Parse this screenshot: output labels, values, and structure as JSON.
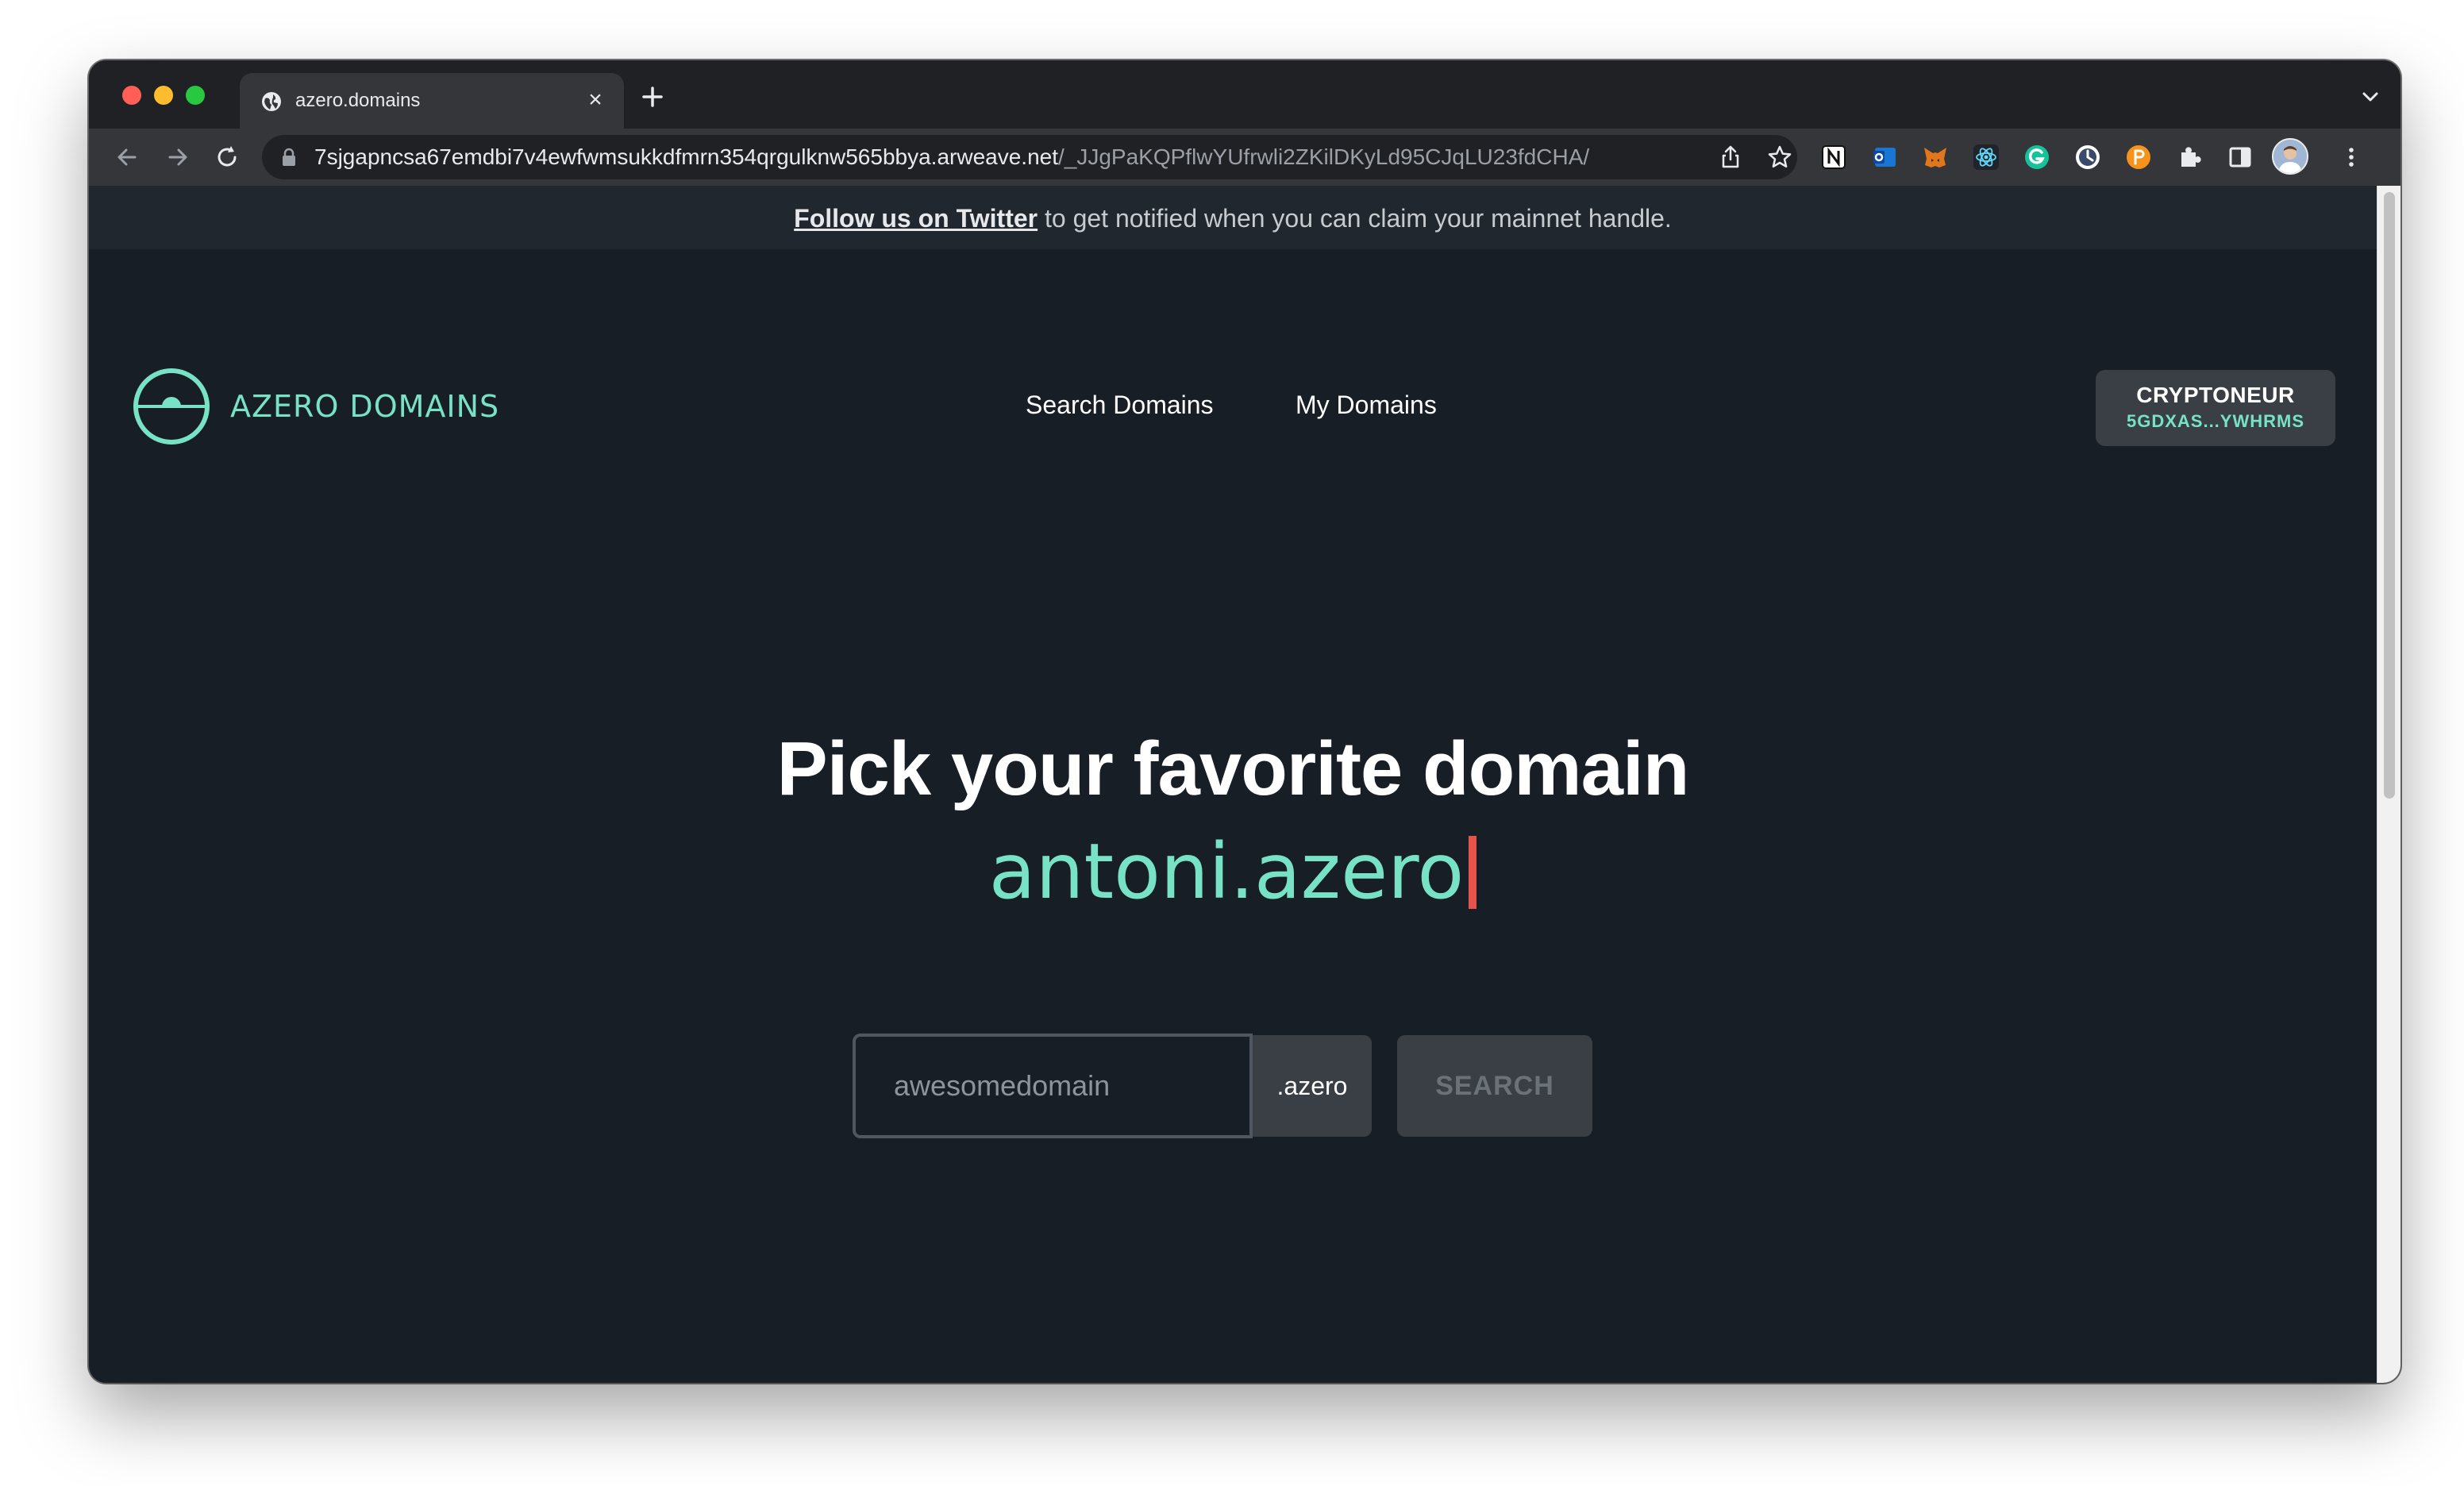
{
  "browser": {
    "tab_title": "azero.domains",
    "tab_close": "×",
    "url_domain": "7sjgapncsa67emdbi7v4ewfwmsukkdfmrn354qrgulknw565bbya.arweave.net",
    "url_path": "/_JJgPaKQPflwYUfrwli2ZKilDKyLd95CJqLU23fdCHA/"
  },
  "banner": {
    "link_text": "Follow us on Twitter",
    "text": " to get notified when you can claim your mainnet handle."
  },
  "header": {
    "brand": "AZERO DOMAINS",
    "nav": [
      "Search Domains",
      "My Domains"
    ],
    "account_name": "CRYPTONEUR",
    "account_address": "5GDXAS...YWHRMS"
  },
  "hero": {
    "title": "Pick your favorite domain",
    "typed_domain": "antoni.azero"
  },
  "search": {
    "placeholder": "awesomedomain",
    "tld": ".azero",
    "button": "SEARCH"
  },
  "colors": {
    "page_bg": "#181e25",
    "accent": "#77e2c6",
    "caret": "#e5534b",
    "button_bg": "#3a3f45"
  }
}
